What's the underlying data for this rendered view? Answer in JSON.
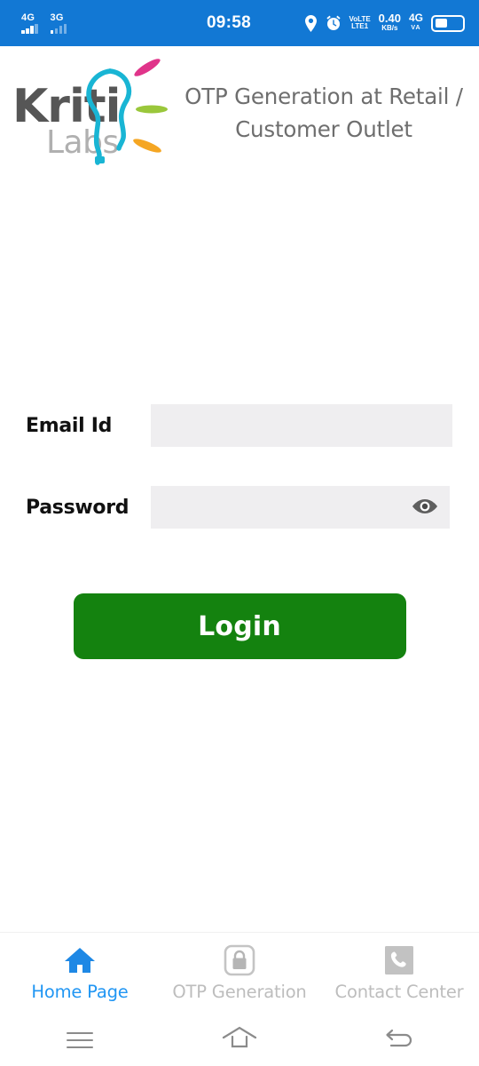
{
  "status_bar": {
    "background": "#1278d4",
    "sim1": {
      "network": "4G",
      "bars_filled": 3,
      "bars_total": 4
    },
    "sim2": {
      "network": "3G",
      "bars_filled": 1,
      "bars_total": 4
    },
    "time": "09:58",
    "location_icon": "location-pin-icon",
    "alarm_icon": "alarm-clock-icon",
    "volte": {
      "line1": "VoLTE",
      "line2": "LTE1"
    },
    "net_speed": {
      "value": "0.40",
      "unit": "KB/s"
    },
    "data_network": {
      "value": "4G",
      "unit": "VA"
    },
    "battery_percent": 45
  },
  "header": {
    "logo": {
      "brand_top": "Kriti",
      "brand_bottom": "Labs",
      "brand_top_color": "#565656",
      "brand_bottom_color": "#b0b0b0",
      "bulb_color": "#19b5d4",
      "ray_pink": "#e0348a",
      "ray_green": "#9ac73b",
      "ray_orange": "#f5a623"
    },
    "title": "OTP Generation at Retail / Customer Outlet",
    "title_color": "#6e6e6e"
  },
  "form": {
    "email": {
      "label": "Email Id",
      "value": "",
      "placeholder": ""
    },
    "password": {
      "label": "Password",
      "value": "",
      "placeholder": "",
      "toggle_icon": "eye-icon"
    },
    "login_button": {
      "label": "Login",
      "color": "#14820f"
    }
  },
  "tab_bar": {
    "active_color": "#2196f3",
    "inactive_color": "#bdbdbd",
    "tabs": [
      {
        "label": "Home Page",
        "icon": "home-icon",
        "active": true
      },
      {
        "label": "OTP Generation",
        "icon": "lock-icon",
        "active": false
      },
      {
        "label": "Contact Center",
        "icon": "phone-icon",
        "active": false
      }
    ]
  },
  "nav_bar": {
    "recents": "recents-icon",
    "home": "home-outline-icon",
    "back": "back-arrow-icon"
  }
}
